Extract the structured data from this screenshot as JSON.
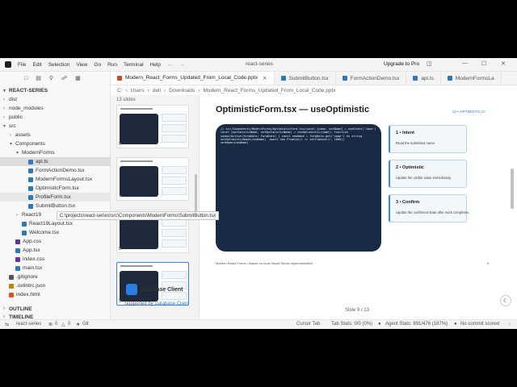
{
  "menubar": {
    "items": [
      "File",
      "Edit",
      "Selection",
      "View",
      "Go",
      "Run",
      "Terminal",
      "Help"
    ],
    "window_title": "react-series",
    "upgrade": "Upgrade to Pro"
  },
  "sidebar": {
    "root": "REACT-SERIES",
    "tree": [
      {
        "label": "dist",
        "type": "folder",
        "depth": 1,
        "expanded": false
      },
      {
        "label": "node_modules",
        "type": "folder",
        "depth": 1,
        "expanded": false
      },
      {
        "label": "public",
        "type": "folder",
        "depth": 1,
        "expanded": false
      },
      {
        "label": "src",
        "type": "folder",
        "depth": 1,
        "expanded": true
      },
      {
        "label": "assets",
        "type": "folder",
        "depth": 2,
        "expanded": false
      },
      {
        "label": "Components",
        "type": "folder",
        "depth": 2,
        "expanded": true
      },
      {
        "label": "ModernForms",
        "type": "folder",
        "depth": 3,
        "expanded": true
      },
      {
        "label": "api.ts",
        "type": "ts",
        "depth": 4,
        "selected": true
      },
      {
        "label": "FormActionDemo.tsx",
        "type": "tsx",
        "depth": 4
      },
      {
        "label": "ModernFormsLayout.tsx",
        "type": "tsx",
        "depth": 4
      },
      {
        "label": "OptimisticForm.tsx",
        "type": "tsx",
        "depth": 4
      },
      {
        "label": "ProfileForm.tsx",
        "type": "tsx",
        "depth": 4,
        "hover": true
      },
      {
        "label": "SubmitButton.tsx",
        "type": "tsx",
        "depth": 4
      },
      {
        "label": "React19",
        "type": "folder",
        "depth": 3,
        "expanded": false
      },
      {
        "label": "React19Layout.tsx",
        "type": "tsx",
        "depth": 3
      },
      {
        "label": "Welcome.tsx",
        "type": "tsx",
        "depth": 3
      },
      {
        "label": "App.css",
        "type": "css",
        "depth": 2
      },
      {
        "label": "App.tsx",
        "type": "tsx",
        "depth": 2
      },
      {
        "label": "index.css",
        "type": "css",
        "depth": 2
      },
      {
        "label": "main.tsx",
        "type": "tsx",
        "depth": 2
      },
      {
        "label": ".gitignore",
        "type": "git",
        "depth": 1
      },
      {
        "label": ".oxlintrc.json",
        "type": "json",
        "depth": 1
      },
      {
        "label": "index.html",
        "type": "html",
        "depth": 1
      }
    ],
    "outline": "OUTLINE",
    "timeline": "TIMELINE",
    "tooltip": "C:\\projects\\react-series\\src\\Components\\ModernForms\\SubmitButton.tsx"
  },
  "tabs": [
    {
      "label": "Modern_React_Forms_Updated_From_Local_Code.pptx",
      "active": true
    },
    {
      "label": "SubmitButton.tsx",
      "active": false
    },
    {
      "label": "FormActionDemo.tsx",
      "active": false
    },
    {
      "label": "api.ts",
      "active": false
    },
    {
      "label": "ModernFormsLa",
      "active": false
    }
  ],
  "breadcrumb": [
    "C:",
    "Users",
    "dell",
    "Downloads",
    "Modern_React_Forms_Updated_From_Local_Code.pptx"
  ],
  "thumbnails": {
    "count_label": "13 slides",
    "items": [
      {
        "num": "6",
        "active": false
      },
      {
        "num": "7",
        "active": false
      },
      {
        "num": "8",
        "active": false
      },
      {
        "num": "9",
        "active": true
      }
    ]
  },
  "promo": {
    "name": "Database Client",
    "supported_prefix": "Supported by",
    "supported_link": "Database Client"
  },
  "slide": {
    "title": "OptimisticForm.tsx — useOptimistic",
    "tag": "04 • OPTIMISTIC UI",
    "code": "// src/Components/ModernForms/OptimisticForm.tsx(const [name, setName] = useState('Jane')\nconst [optimisticName, setOptimisticName] = useOptimistic(name); function\nsubmitAction(formData: FormData) { const newName = formData.get('name') as string\nsetOptimisticName(newName)  await new Promise(r => setTimeout(r, 1000))\nsetName(newName)",
    "cards": [
      {
        "title": "1 • Intent",
        "desc": "Read the submitted name."
      },
      {
        "title": "2 • Optimistic",
        "desc": "Update the visible value immediately."
      },
      {
        "title": "3 • Confirm",
        "desc": "Update the confirmed state after work completes."
      }
    ],
    "footer": "Modern React Forms • Based on local Visual Studio implementation",
    "page": "9",
    "counter": "Slide 9 / 13"
  },
  "status": {
    "branch": "react-series",
    "errors": "0",
    "warnings": "0",
    "git": "Git",
    "cursor_tab": "Cursor Tab",
    "tab_stats": "Tab Stats: 0/0 (0%)",
    "agent_stats": "Agent Stats: 891/476 (187%)",
    "commit": "No commit scored"
  }
}
